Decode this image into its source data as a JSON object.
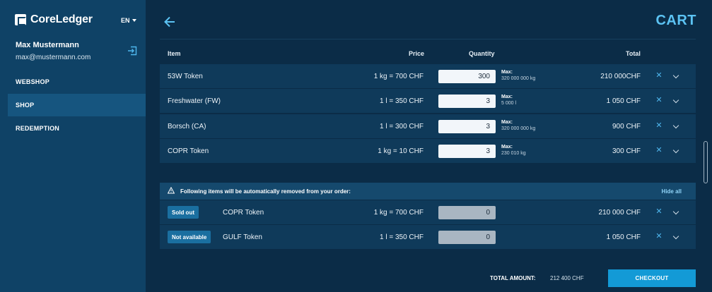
{
  "app": {
    "brand": "CoreLedger",
    "language": "EN"
  },
  "user": {
    "name": "Max Mustermann",
    "email": "max@mustermann.com"
  },
  "nav": [
    {
      "label": "WEBSHOP",
      "active": false
    },
    {
      "label": "SHOP",
      "active": true
    },
    {
      "label": "REDEMPTION",
      "active": false
    }
  ],
  "page": {
    "title": "CART"
  },
  "table": {
    "headers": {
      "item": "Item",
      "price": "Price",
      "quantity": "Quantity",
      "total": "Total"
    }
  },
  "items": [
    {
      "name": "53W Token",
      "price": "1 kg = 700 CHF",
      "quantity": "300",
      "max_label": "Max:",
      "max_value": "320 000 000 kg",
      "total": "210 000CHF"
    },
    {
      "name": "Freshwater (FW)",
      "price": "1 l = 350 CHF",
      "quantity": "3",
      "max_label": "Max:",
      "max_value": "5 000 l",
      "total": "1 050  CHF"
    },
    {
      "name": "Borsch (CA)",
      "price": "1 l = 300 CHF",
      "quantity": "3",
      "max_label": "Max:",
      "max_value": "320 000 000 kg",
      "total": "900  CHF"
    },
    {
      "name": "COPR Token",
      "price": "1 kg = 10 CHF",
      "quantity": "3",
      "max_label": "Max:",
      "max_value": "230 010 kg",
      "total": "300 CHF"
    }
  ],
  "warning": {
    "text": "Following items will be automatically removed from your order:",
    "hide_all": "Hide all"
  },
  "removed_items": [
    {
      "badge": "Sold out",
      "name": "COPR Token",
      "price": "1 kg = 700 CHF",
      "quantity": "0",
      "total": "210 000 CHF"
    },
    {
      "badge": "Not available",
      "name": "GULF Token",
      "price": "1 l = 350 CHF",
      "quantity": "0",
      "total": "1 050  CHF"
    }
  ],
  "footer": {
    "total_label": "TOTAL AMOUNT:",
    "total_value": "212 400 CHF",
    "checkout_label": "CHECKOUT"
  },
  "colors": {
    "sidebar": "#0f4266",
    "background": "#0b2c47",
    "accent": "#5cc3f3",
    "checkout": "#139ad6",
    "badge": "#1a6fa0"
  }
}
